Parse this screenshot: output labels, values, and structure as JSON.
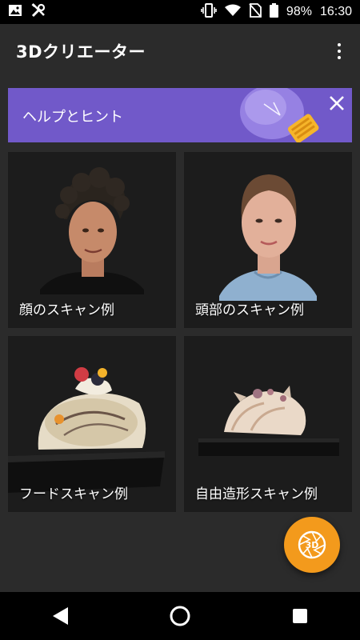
{
  "status_bar": {
    "battery_percent": "98%",
    "time": "16:30",
    "icons": [
      "image-icon",
      "tools-icon",
      "vibrate-icon",
      "wifi-icon",
      "no-sim-icon",
      "battery-icon"
    ]
  },
  "app_bar": {
    "title": "3Dクリエーター",
    "menu_icon": "more-vert-icon"
  },
  "help_banner": {
    "title": "ヘルプとヒント",
    "icon": "lightbulb-icon",
    "close_icon": "close-icon",
    "color": "#7159c9"
  },
  "cards": [
    {
      "label": "顔のスキャン例",
      "image": "face-scan-image"
    },
    {
      "label": "頭部のスキャン例",
      "image": "head-scan-image"
    },
    {
      "label": "フードスキャン例",
      "image": "food-scan-image"
    },
    {
      "label": "自由造形スキャン例",
      "image": "freeform-scan-image"
    }
  ],
  "fab": {
    "label": "3D",
    "icon": "camera-shutter-icon",
    "color": "#f39a1c"
  },
  "nav_bar": {
    "icons": [
      "back-icon",
      "home-icon",
      "recents-icon"
    ]
  }
}
